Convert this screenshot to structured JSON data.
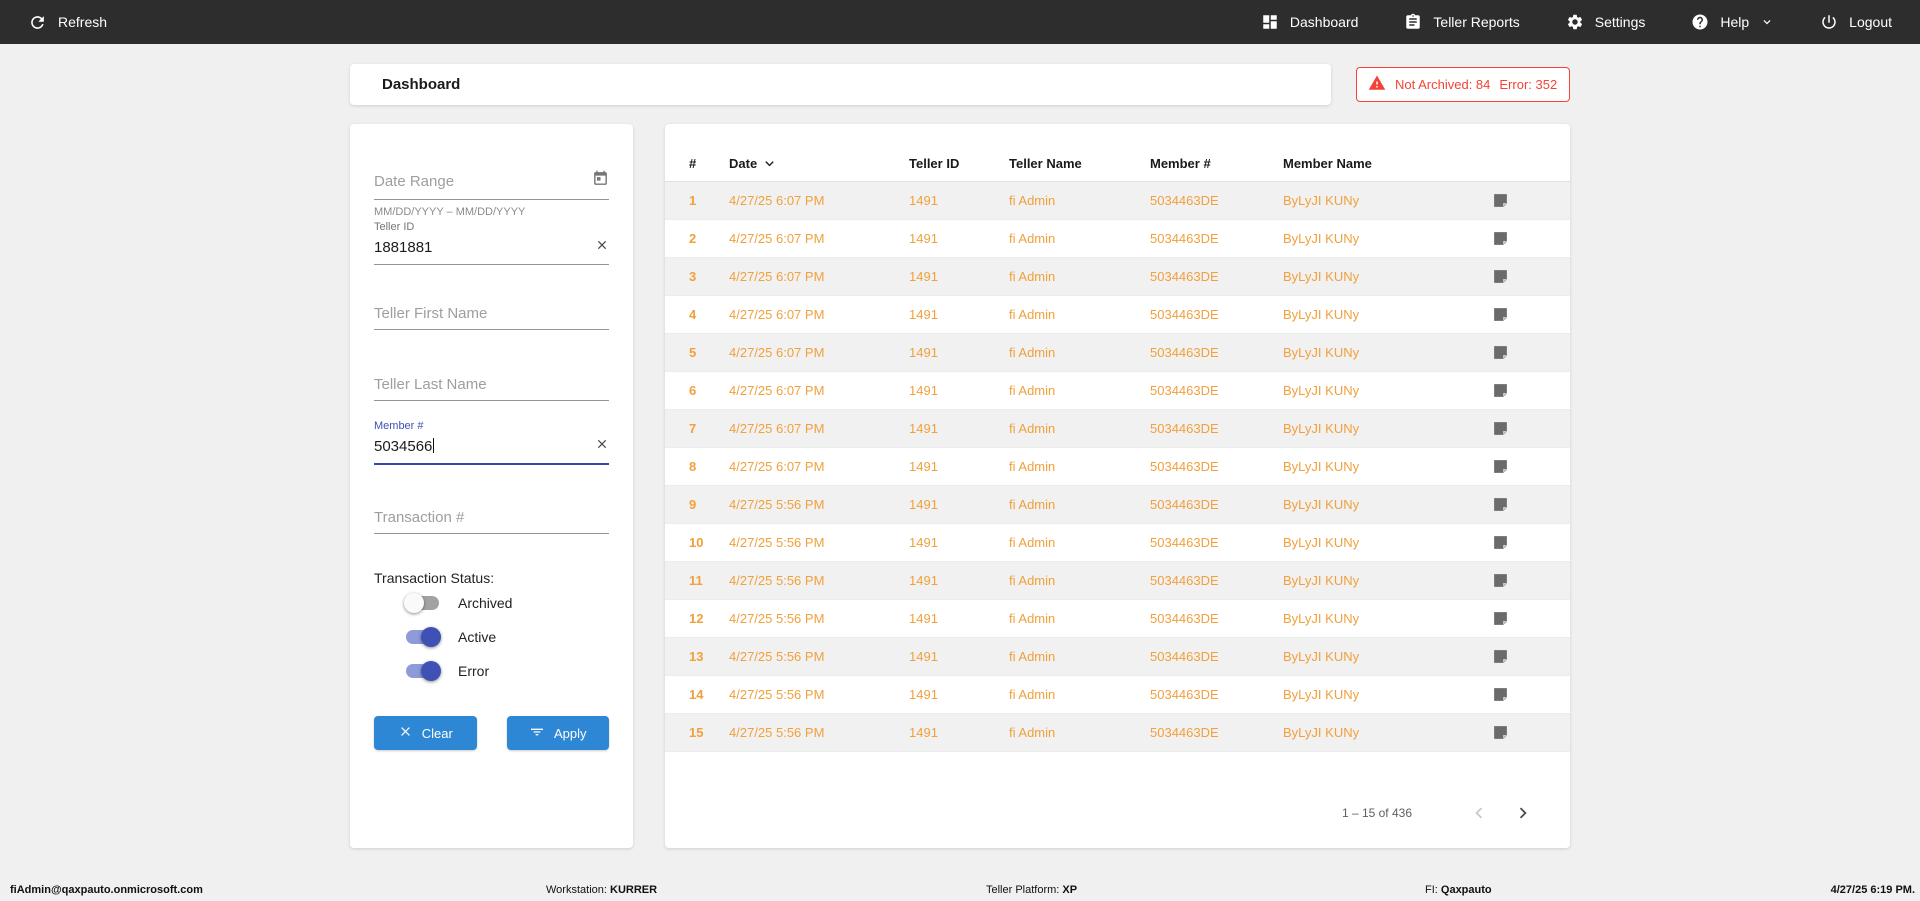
{
  "topbar": {
    "refresh_label": "Refresh",
    "nav": [
      {
        "label": "Dashboard"
      },
      {
        "label": "Teller Reports"
      },
      {
        "label": "Settings"
      },
      {
        "label": "Help"
      },
      {
        "label": "Logout"
      }
    ]
  },
  "header": {
    "title": "Dashboard",
    "alert": {
      "not_archived": "Not Archived: 84",
      "error": "Error: 352"
    }
  },
  "filters": {
    "date_range": {
      "placeholder": "Date Range",
      "hint": "MM/DD/YYYY – MM/DD/YYYY"
    },
    "teller_id": {
      "label": "Teller ID",
      "value": "1881881"
    },
    "teller_first_name": {
      "placeholder": "Teller First Name"
    },
    "teller_last_name": {
      "placeholder": "Teller Last Name"
    },
    "member_number": {
      "label": "Member #",
      "value": "5034566"
    },
    "transaction_number": {
      "placeholder": "Transaction #"
    },
    "status_label": "Transaction Status:",
    "toggles": [
      {
        "label": "Archived",
        "on": false
      },
      {
        "label": "Active",
        "on": true
      },
      {
        "label": "Error",
        "on": true
      }
    ],
    "clear_label": "Clear",
    "apply_label": "Apply"
  },
  "table": {
    "columns": [
      "#",
      "Date",
      "Teller ID",
      "Teller Name",
      "Member #",
      "Member Name"
    ],
    "sorted_by": "Date",
    "rows": [
      {
        "num": "1",
        "date": "4/27/25 6:07 PM",
        "teller_id": "1491",
        "teller_name": "fi Admin",
        "member_number": "5034463DE",
        "member_name": "ByLyJI KUNy"
      },
      {
        "num": "2",
        "date": "4/27/25 6:07 PM",
        "teller_id": "1491",
        "teller_name": "fi Admin",
        "member_number": "5034463DE",
        "member_name": "ByLyJI KUNy"
      },
      {
        "num": "3",
        "date": "4/27/25 6:07 PM",
        "teller_id": "1491",
        "teller_name": "fi Admin",
        "member_number": "5034463DE",
        "member_name": "ByLyJI KUNy"
      },
      {
        "num": "4",
        "date": "4/27/25 6:07 PM",
        "teller_id": "1491",
        "teller_name": "fi Admin",
        "member_number": "5034463DE",
        "member_name": "ByLyJI KUNy"
      },
      {
        "num": "5",
        "date": "4/27/25 6:07 PM",
        "teller_id": "1491",
        "teller_name": "fi Admin",
        "member_number": "5034463DE",
        "member_name": "ByLyJI KUNy"
      },
      {
        "num": "6",
        "date": "4/27/25 6:07 PM",
        "teller_id": "1491",
        "teller_name": "fi Admin",
        "member_number": "5034463DE",
        "member_name": "ByLyJI KUNy"
      },
      {
        "num": "7",
        "date": "4/27/25 6:07 PM",
        "teller_id": "1491",
        "teller_name": "fi Admin",
        "member_number": "5034463DE",
        "member_name": "ByLyJI KUNy"
      },
      {
        "num": "8",
        "date": "4/27/25 6:07 PM",
        "teller_id": "1491",
        "teller_name": "fi Admin",
        "member_number": "5034463DE",
        "member_name": "ByLyJI KUNy"
      },
      {
        "num": "9",
        "date": "4/27/25 5:56 PM",
        "teller_id": "1491",
        "teller_name": "fi Admin",
        "member_number": "5034463DE",
        "member_name": "ByLyJI KUNy"
      },
      {
        "num": "10",
        "date": "4/27/25 5:56 PM",
        "teller_id": "1491",
        "teller_name": "fi Admin",
        "member_number": "5034463DE",
        "member_name": "ByLyJI KUNy"
      },
      {
        "num": "11",
        "date": "4/27/25 5:56 PM",
        "teller_id": "1491",
        "teller_name": "fi Admin",
        "member_number": "5034463DE",
        "member_name": "ByLyJI KUNy"
      },
      {
        "num": "12",
        "date": "4/27/25 5:56 PM",
        "teller_id": "1491",
        "teller_name": "fi Admin",
        "member_number": "5034463DE",
        "member_name": "ByLyJI KUNy"
      },
      {
        "num": "13",
        "date": "4/27/25 5:56 PM",
        "teller_id": "1491",
        "teller_name": "fi Admin",
        "member_number": "5034463DE",
        "member_name": "ByLyJI KUNy"
      },
      {
        "num": "14",
        "date": "4/27/25 5:56 PM",
        "teller_id": "1491",
        "teller_name": "fi Admin",
        "member_number": "5034463DE",
        "member_name": "ByLyJI KUNy"
      },
      {
        "num": "15",
        "date": "4/27/25 5:56 PM",
        "teller_id": "1491",
        "teller_name": "fi Admin",
        "member_number": "5034463DE",
        "member_name": "ByLyJI KUNy"
      }
    ],
    "pagination": {
      "range_label": "1 – 15 of 436"
    }
  },
  "footer": {
    "user": "fiAdmin@qaxpauto.onmicrosoft.com",
    "workstation_label": "Workstation: ",
    "workstation": "KURRER",
    "platform_label": "Teller Platform: ",
    "platform": "XP",
    "fi_label": "FI: ",
    "fi": "Qaxpauto",
    "datetime": "4/27/25 6:19 PM."
  },
  "colors": {
    "topbar_bg": "#2d2d2d",
    "accent_blue": "#2e87d5",
    "indigo": "#3f51b5",
    "row_orange": "#f1a03c",
    "alert_red": "#f44336",
    "note_icon_gray": "#6b6b6b"
  }
}
